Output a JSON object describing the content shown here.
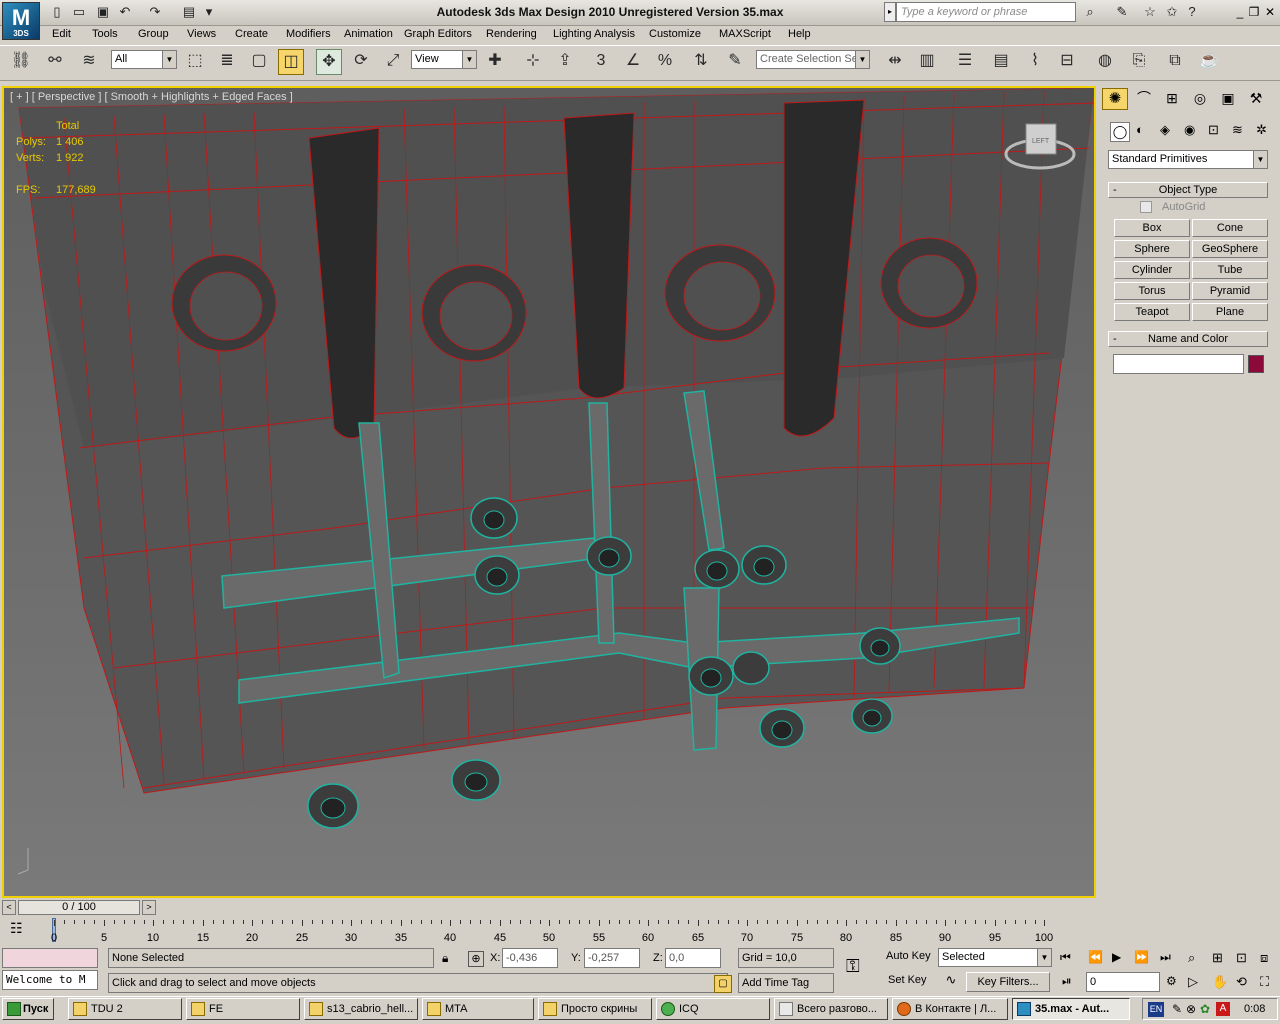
{
  "app": {
    "logo_text": "M",
    "logo_sub": "3DS",
    "title": "Autodesk 3ds Max Design 2010    Unregistered Version     35.max",
    "search_placeholder": "Type a keyword or phrase"
  },
  "menus": [
    "Edit",
    "Tools",
    "Group",
    "Views",
    "Create",
    "Modifiers",
    "Animation",
    "Graph Editors",
    "Rendering",
    "Lighting Analysis",
    "Customize",
    "MAXScript",
    "Help"
  ],
  "toolbar": {
    "filter_value": "All",
    "refcoord_value": "View",
    "selection_set_placeholder": "Create Selection Se",
    "snap_labels": [
      "3",
      "%"
    ]
  },
  "viewport": {
    "label": "[ + ] [ Perspective ] [ Smooth + Highlights + Edged Faces ]",
    "stats": {
      "total_label": "Total",
      "polys_label": "Polys:",
      "polys_value": "1 406",
      "verts_label": "Verts:",
      "verts_value": "1 922",
      "fps_label": "FPS:",
      "fps_value": "177,689"
    },
    "viewcube_label": "LEFT",
    "colors": {
      "wire_red": "#c01818",
      "wire_teal": "#1fb3a0",
      "border_active": "#f0d000"
    }
  },
  "command_panel": {
    "category_dropdown": "Standard Primitives",
    "object_type_title": "Object Type",
    "autogrid_label": "AutoGrid",
    "primitives": [
      "Box",
      "Cone",
      "Sphere",
      "GeoSphere",
      "Cylinder",
      "Tube",
      "Torus",
      "Pyramid",
      "Teapot",
      "Plane"
    ],
    "name_color_title": "Name and Color",
    "name_value": "",
    "object_color": "#8b0a3a"
  },
  "timeline": {
    "frame_display": "0 / 100",
    "ticks": [
      "0",
      "5",
      "10",
      "15",
      "20",
      "25",
      "30",
      "35",
      "40",
      "45",
      "50",
      "55",
      "60",
      "65",
      "70",
      "75",
      "80",
      "85",
      "90",
      "95",
      "100"
    ]
  },
  "status": {
    "maxscript_listener": "Welcome to M",
    "selection_status": "None Selected",
    "prompt": "Click and drag to select and move objects",
    "x_label": "X:",
    "x_value": "-0,436",
    "y_label": "Y:",
    "y_value": "-0,257",
    "z_label": "Z:",
    "z_value": "0,0",
    "grid": "Grid = 10,0",
    "add_time_tag": "Add Time Tag",
    "auto_key": "Auto Key",
    "set_key": "Set Key",
    "key_mode": "Selected",
    "key_filters": "Key Filters...",
    "current_frame": "0"
  },
  "taskbar": {
    "start_label": "Пуск",
    "tasks": [
      "TDU 2",
      "FE",
      "s13_cabrio_hell...",
      "MTA",
      "Просто скрины",
      "ICQ",
      "Всего разгово...",
      "В Контакте | Л...",
      "35.max - Aut..."
    ],
    "lang": "EN",
    "clock": "0:08"
  }
}
